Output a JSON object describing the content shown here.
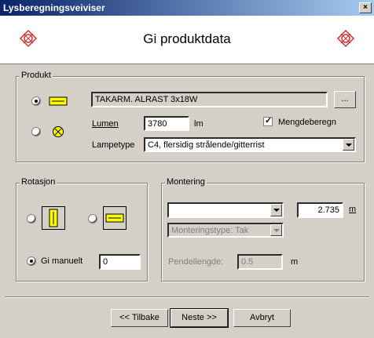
{
  "window": {
    "title": "Lysberegningsveiviser"
  },
  "header": {
    "title": "Gi produktdata"
  },
  "produkt": {
    "group_label": "Produkt",
    "product_name": "TAKARM. ALRAST 3x18W",
    "browse_label": "...",
    "lumen_label": "Lumen",
    "lumen_value": "3780",
    "lumen_unit": "lm",
    "mengde_label": "Mengdeberegn",
    "mengde_checked": true,
    "lampetype_label": "Lampetype",
    "lampetype_value": "C4, flersidig strålende/gitterrist",
    "selected_type": "linear"
  },
  "rotasjon": {
    "group_label": "Rotasjon",
    "manual_label": "Gi manuelt",
    "manual_value": "0",
    "selected": "manual"
  },
  "montering": {
    "group_label": "Montering",
    "select_value": "",
    "height_value": "2.735",
    "height_unit": "m",
    "type_value": "Monteringstype: Tak",
    "pendel_label": "Pendellengde:",
    "pendel_value": "0.5",
    "pendel_unit": "m"
  },
  "buttons": {
    "back": "<< Tilbake",
    "next": "Neste >>",
    "cancel": "Avbryt"
  },
  "colors": {
    "lamp_yellow": "#ffff00",
    "logo_red": "#cc3333"
  }
}
